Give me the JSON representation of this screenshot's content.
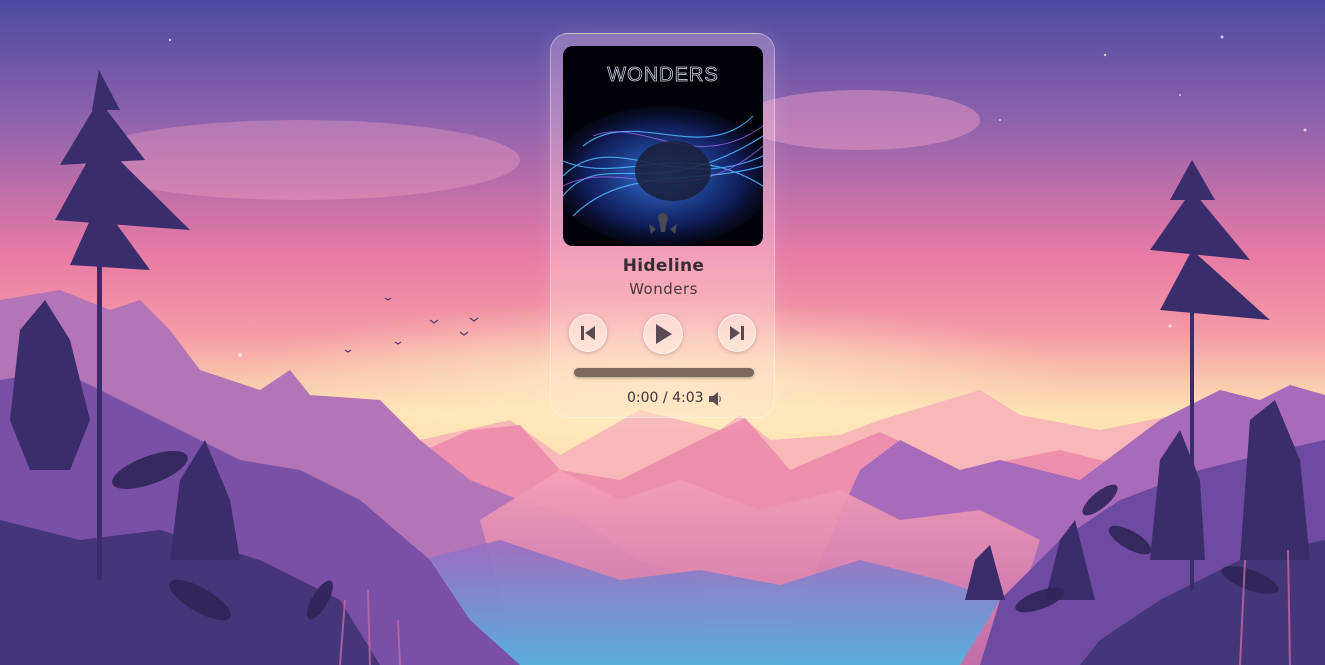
{
  "player": {
    "cover_text": "WONDERS",
    "title": "Hideline",
    "artist": "Wonders",
    "current_time": "0:00",
    "time_separator": " / ",
    "duration": "4:03",
    "progress_fraction": 0
  },
  "icons": {
    "prev": "skip-previous-icon",
    "play": "play-icon",
    "next": "skip-next-icon",
    "volume": "volume-icon"
  },
  "colors": {
    "sky_top": "#4b4aa0",
    "sky_mid": "#f183a8",
    "horizon": "#fde3b2",
    "icon": "#5b4a54"
  }
}
